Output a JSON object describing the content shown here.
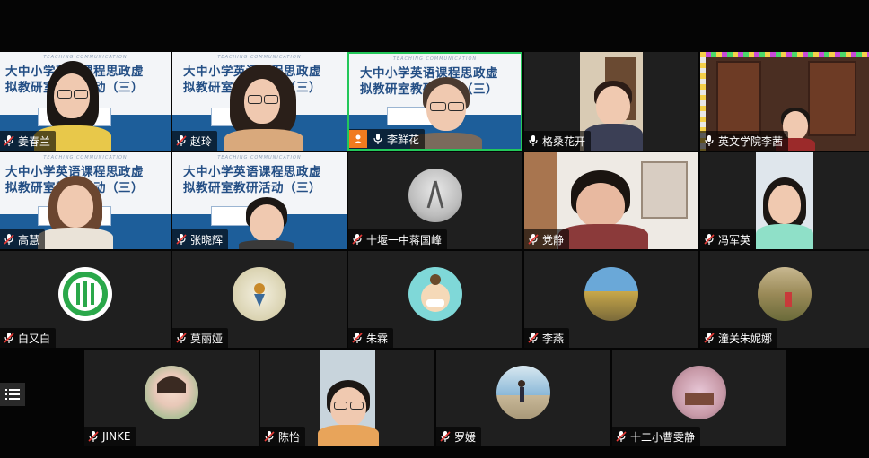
{
  "participants": [
    {
      "id": "p1",
      "name": "姜春兰"
    },
    {
      "id": "p2",
      "name": "赵玲"
    },
    {
      "id": "p3",
      "name": "李鲜花"
    },
    {
      "id": "p4",
      "name": "格桑花开"
    },
    {
      "id": "p5",
      "name": "英文学院李茜"
    },
    {
      "id": "p6",
      "name": "高慧"
    },
    {
      "id": "p7",
      "name": "张晓辉"
    },
    {
      "id": "p8",
      "name": "十堰一中蒋国峰"
    },
    {
      "id": "p9",
      "name": "党静"
    },
    {
      "id": "p10",
      "name": "冯军英"
    },
    {
      "id": "p11",
      "name": "白又白"
    },
    {
      "id": "p12",
      "name": "莫丽娅"
    },
    {
      "id": "p13",
      "name": "朱霖"
    },
    {
      "id": "p14",
      "name": "李燕"
    },
    {
      "id": "p15",
      "name": "潼关朱妮娜"
    },
    {
      "id": "p16",
      "name": "JINKE"
    },
    {
      "id": "p17",
      "name": "陈怡"
    },
    {
      "id": "p18",
      "name": "罗媛"
    },
    {
      "id": "p19",
      "name": "十二小曹雯静"
    }
  ],
  "slide": {
    "title_line1": "大中小学英语课程思政虚",
    "title_line2": "拟教研室教研活动（三）",
    "tag": "TEACHING COMMUNICATION"
  },
  "colors": {
    "active_border": "#23c75a",
    "slide_band": "#1d5e9a",
    "tile_bg": "#1f1f1f"
  },
  "icons": {
    "mic": "microphone-muted-icon",
    "menu": "menu-icon",
    "user": "user-icon"
  }
}
